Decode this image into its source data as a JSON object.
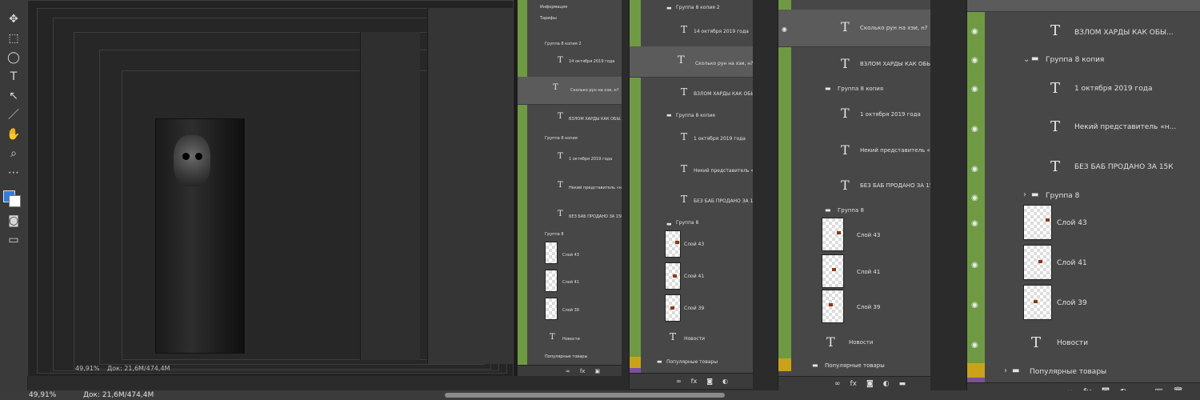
{
  "status": {
    "zoom": "49,91%",
    "doc": "Док: 21,6M/474,4M"
  },
  "inner_status": {
    "zoom": "49,91%",
    "doc": "Док: 21,6M/474,4M"
  },
  "tools": [
    "↔",
    "⬚",
    "⌖",
    "✦",
    "✎",
    "⬛",
    "T",
    "↖",
    "/",
    "✋",
    "🔍",
    "…"
  ],
  "layers": {
    "group_copy2": "Группа 8 копия 2",
    "date_oct14": "14 октября 2019 года",
    "rune_question": "Сколько рун на хэи, н?",
    "hack": "ВЗЛОМ ХАРДЫ КАК ОБЫ...",
    "group_copy": "Группа 8 копия",
    "date_oct1": "1 октября 2019 года",
    "some_rep": "Некий представитель «н...",
    "no_women": "БЕЗ БАБ ПРОДАНО ЗА 15К",
    "group8": "Группа 8",
    "layer43": "Слой 43",
    "layer41": "Слой 41",
    "layer39": "Слой 39",
    "news": "Новости",
    "popular": "Популярные товары",
    "info": "Информация",
    "tariffs": "Тарифы"
  },
  "icons": {
    "eye": "eye-icon",
    "type": "text-layer-icon",
    "folder": "folder-icon"
  },
  "colors": {
    "accent_green": "#6f9a43",
    "fg_swatch": "#2f7de1",
    "yellow": "#c9a21a",
    "purple": "#7b4fa0"
  }
}
